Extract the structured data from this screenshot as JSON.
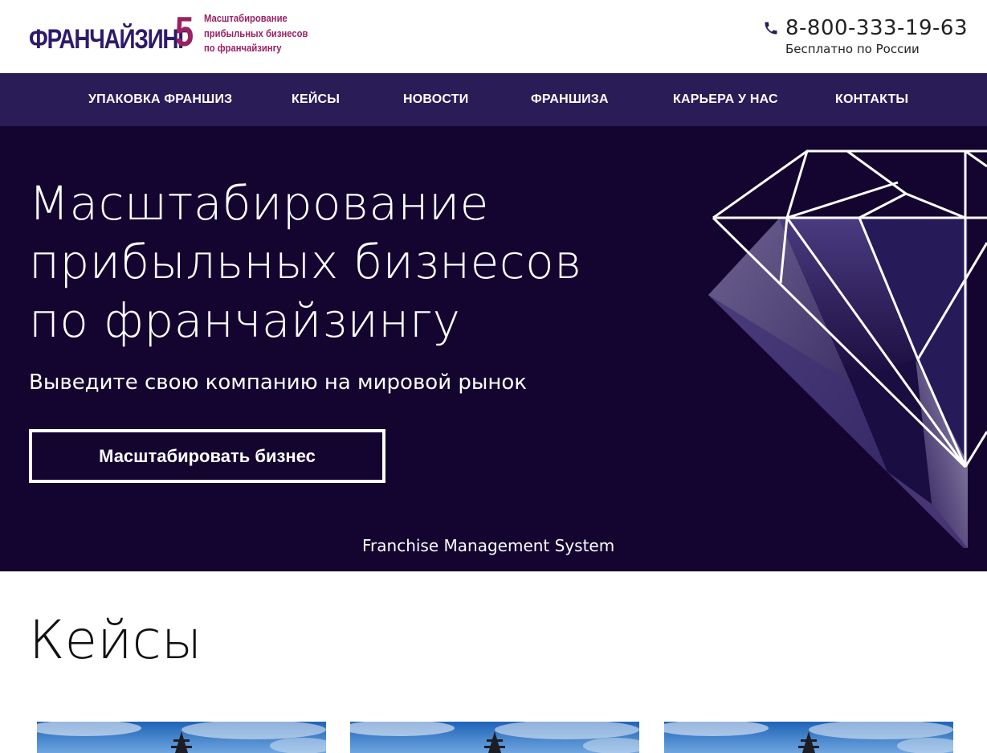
{
  "header": {
    "logo": {
      "word": "ФРАНЧАЙЗИНГ",
      "digit": "5",
      "tagline": [
        "Масштабирование",
        "прибыльных бизнесов",
        "по франчайзингу"
      ]
    },
    "phone": {
      "number": "8-800-333-19-63",
      "note": "Бесплатно по России",
      "icon": "phone-icon"
    }
  },
  "nav": {
    "items": [
      {
        "label": "УПАКОВКА ФРАНШИЗ"
      },
      {
        "label": "КЕЙСЫ"
      },
      {
        "label": "НОВОСТИ"
      },
      {
        "label": "ФРАНШИЗА"
      },
      {
        "label": "КАРЬЕРА У НАС"
      },
      {
        "label": "КОНТАКТЫ"
      }
    ]
  },
  "hero": {
    "title_lines": [
      "Масштабирование",
      "прибыльных бизнесов",
      "по франчайзингу"
    ],
    "subtitle": "Выведите свою компанию на мировой рынок",
    "button_label": "Масштабировать бизнес",
    "caption": "Franchise Management System",
    "icon": "diamond-illustration"
  },
  "cases": {
    "title": "Кейсы",
    "cards": [
      {
        "image": "temple-sky-photo"
      },
      {
        "image": "temple-sky-photo"
      },
      {
        "image": "temple-sky-photo"
      }
    ]
  },
  "colors": {
    "brand_dark": "#2e1a6b",
    "brand_accent": "#9b2164",
    "nav_bg": "#2a1c57",
    "hero_bg": "#130530"
  }
}
